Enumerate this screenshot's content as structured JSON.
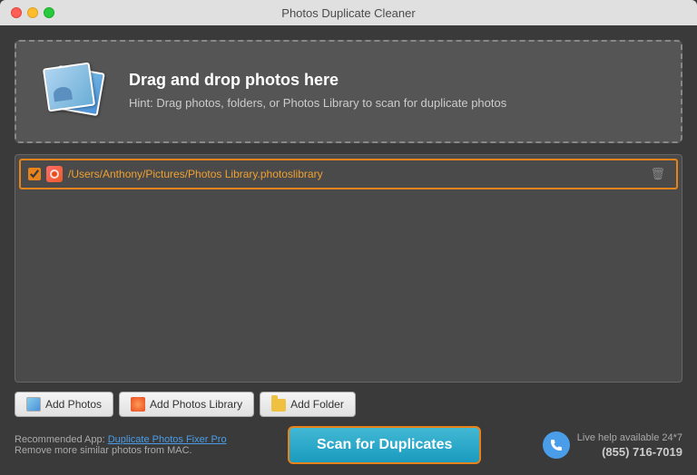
{
  "titlebar": {
    "title": "Photos Duplicate Cleaner"
  },
  "dropzone": {
    "heading": "Drag and drop photos here",
    "hint": "Hint: Drag photos, folders, or Photos Library to scan for duplicate photos"
  },
  "file_list": [
    {
      "path": "/Users/Anthony/Pictures/Photos Library.photoslibrary",
      "checked": true
    }
  ],
  "toolbar": {
    "add_photos_label": "Add Photos",
    "add_library_label": "Add Photos Library",
    "add_folder_label": "Add Folder"
  },
  "footer": {
    "recommended_prefix": "Recommended App: ",
    "recommended_link": "Duplicate Photos Fixer Pro",
    "remove_text": "Remove more similar photos from MAC.",
    "scan_button": "Scan for Duplicates",
    "live_help": "Live help available 24*7",
    "phone": "(855) 716-7019"
  }
}
